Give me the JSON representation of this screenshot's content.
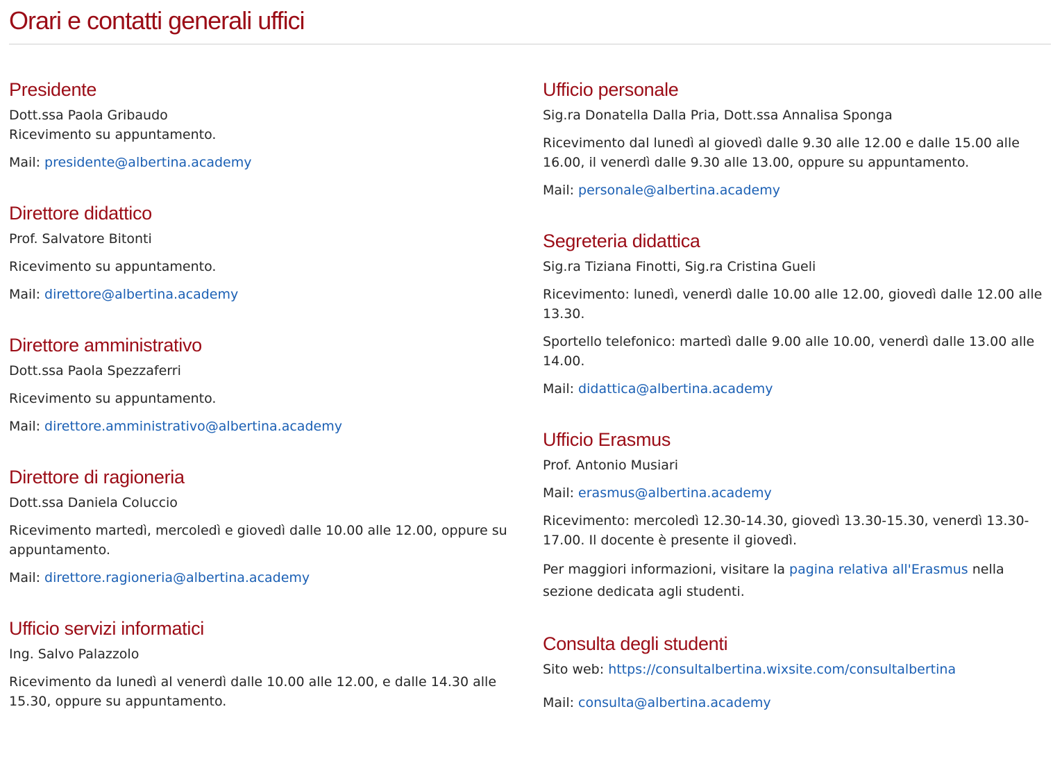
{
  "page": {
    "title": "Orari e contatti generali uffici"
  },
  "mail_label": "Mail: ",
  "left": {
    "presidente": {
      "heading": "Presidente",
      "person": "Dott.ssa Paola Gribaudo",
      "hours": "Ricevimento su appuntamento.",
      "mail": "presidente@albertina.academy"
    },
    "direttore_didattico": {
      "heading": "Direttore didattico",
      "person": "Prof. Salvatore Bitonti",
      "hours": "Ricevimento su appuntamento.",
      "mail": "direttore@albertina.academy"
    },
    "direttore_amministrativo": {
      "heading": "Direttore amministrativo",
      "person": "Dott.ssa Paola Spezzaferri",
      "hours": "Ricevimento su appuntamento.",
      "mail": "direttore.amministrativo@albertina.academy"
    },
    "direttore_ragioneria": {
      "heading": "Direttore di ragioneria",
      "person": "Dott.ssa Daniela Coluccio",
      "hours": "Ricevimento martedì, mercoledì e giovedì dalle 10.00 alle 12.00, oppure su appuntamento.",
      "mail": "direttore.ragioneria@albertina.academy"
    },
    "servizi_informatici": {
      "heading": "Ufficio servizi informatici",
      "person": "Ing. Salvo Palazzolo",
      "hours": "Ricevimento da lunedì al venerdì dalle 10.00 alle 12.00, e dalle 14.30 alle 15.30, oppure su appuntamento."
    }
  },
  "right": {
    "personale": {
      "heading": "Ufficio personale",
      "person": "Sig.ra Donatella Dalla Pria, Dott.ssa Annalisa Sponga",
      "hours": "Ricevimento dal lunedì al giovedì dalle 9.30 alle 12.00 e dalle 15.00 alle 16.00, il venerdì dalle 9.30 alle 13.00, oppure su appuntamento.",
      "mail": "personale@albertina.academy"
    },
    "segreteria": {
      "heading": "Segreteria didattica",
      "person": "Sig.ra Tiziana Finotti, Sig.ra Cristina Gueli",
      "hours": "Ricevimento: lunedì, venerdì dalle 10.00 alle 12.00, giovedì dalle 12.00 alle 13.30.",
      "phone": "Sportello telefonico: martedì dalle 9.00 alle 10.00, venerdì dalle 13.00 alle 14.00.",
      "mail": "didattica@albertina.academy"
    },
    "erasmus": {
      "heading": "Ufficio Erasmus",
      "person": "Prof. Antonio Musiari",
      "mail": "erasmus@albertina.academy",
      "hours": "Ricevimento: mercoledì 12.30-14.30, giovedì 13.30-15.30, venerdì 13.30-17.00. Il docente è presente il giovedì.",
      "info_prefix": "Per maggiori informazioni, visitare la ",
      "info_link": "pagina relativa all'Erasmus",
      "info_suffix": " nella sezione dedicata agli studenti."
    },
    "consulta": {
      "heading": "Consulta degli studenti",
      "site_label": "Sito web: ",
      "site": "https://consultalbertina.wixsite.com/consultalbertina",
      "mail": "consulta@albertina.academy"
    }
  }
}
